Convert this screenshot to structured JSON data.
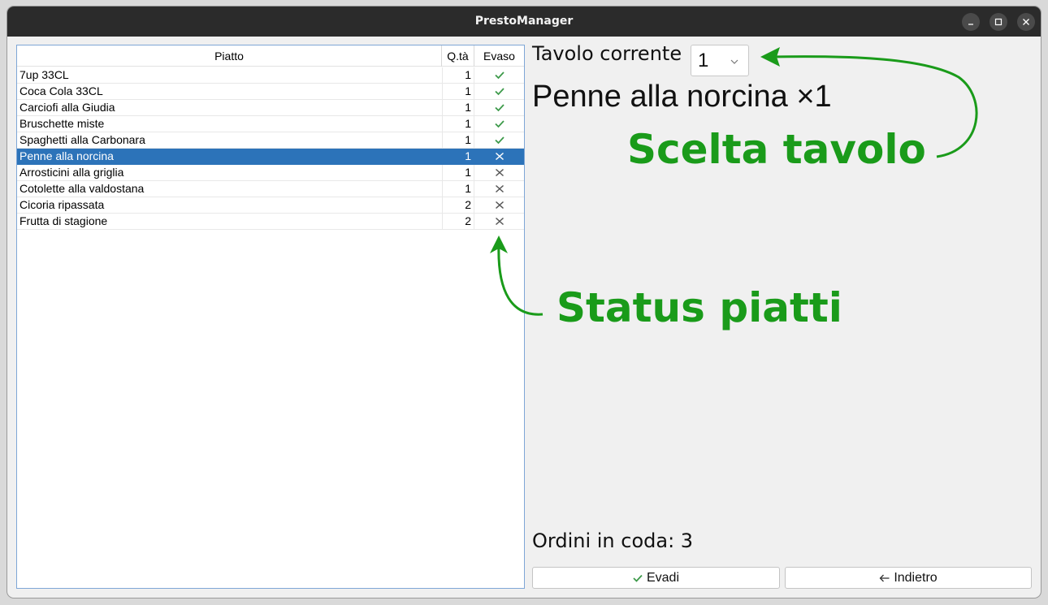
{
  "window": {
    "title": "PrestoManager"
  },
  "table": {
    "headers": {
      "dish": "Piatto",
      "qty": "Q.tà",
      "status": "Evaso"
    },
    "rows": [
      {
        "dish": "7up 33CL",
        "qty": "1",
        "done": true
      },
      {
        "dish": "Coca Cola 33CL",
        "qty": "1",
        "done": true
      },
      {
        "dish": "Carciofi alla Giudia",
        "qty": "1",
        "done": true
      },
      {
        "dish": "Bruschette miste",
        "qty": "1",
        "done": true
      },
      {
        "dish": "Spaghetti alla Carbonara",
        "qty": "1",
        "done": true
      },
      {
        "dish": "Penne alla norcina",
        "qty": "1",
        "done": false,
        "selected": true
      },
      {
        "dish": "Arrosticini alla griglia",
        "qty": "1",
        "done": false
      },
      {
        "dish": "Cotolette alla valdostana",
        "qty": "1",
        "done": false
      },
      {
        "dish": "Cicoria ripassata",
        "qty": "2",
        "done": false
      },
      {
        "dish": "Frutta di stagione",
        "qty": "2",
        "done": false
      }
    ]
  },
  "panel": {
    "table_label": "Tavolo corrente",
    "table_value": "1",
    "current_dish": "Penne alla norcina ×1",
    "queue": "Ordini in coda: 3",
    "evadi_label": "Evadi",
    "back_label": "Indietro"
  },
  "annotations": {
    "table_choice": "Scelta tavolo",
    "dish_status": "Status piatti"
  },
  "colors": {
    "annotation_green": "#1a9b1a",
    "check_green": "#3d9a4a",
    "selection_blue": "#2c73b9",
    "titlebar": "#2b2b2b"
  },
  "icons": {
    "done": "check-icon",
    "not_done": "cross-icon",
    "combo": "chevron-down-icon",
    "back": "arrow-left-icon"
  }
}
